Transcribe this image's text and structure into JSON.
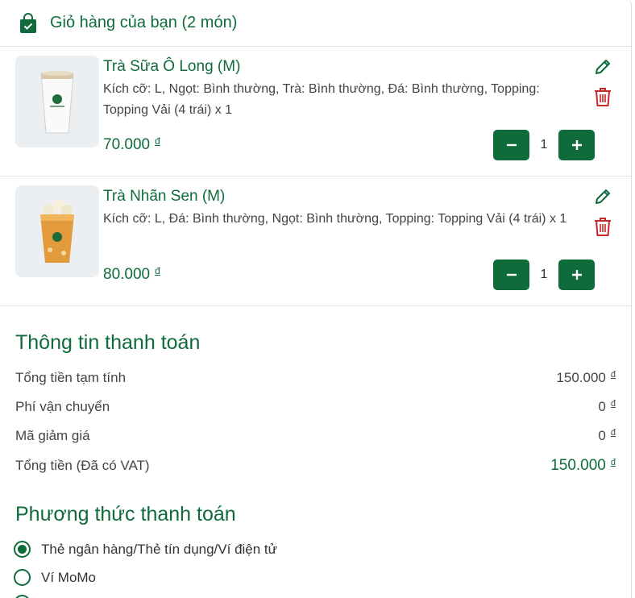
{
  "cart": {
    "title": "Giỏ hàng của bạn (2 món)",
    "icon": "shopping-bag-icon",
    "items": [
      {
        "name": "Trà Sữa Ô Long (M)",
        "description": "Kích cỡ: L, Ngọt: Bình thường, Trà: Bình thường, Đá: Bình thường, Topping: Topping Vải (4 trái) x 1",
        "price": "70.000",
        "currency": "đ",
        "quantity": "1"
      },
      {
        "name": "Trà Nhãn Sen (M)",
        "description": "Kích cỡ: L, Đá: Bình thường, Ngọt: Bình thường, Topping: Topping Vải (4 trái) x 1",
        "price": "80.000",
        "currency": "đ",
        "quantity": "1"
      }
    ]
  },
  "payment_info": {
    "title": "Thông tin thanh toán",
    "rows": [
      {
        "label": "Tổng tiền tạm tính",
        "value": "150.000",
        "currency": "đ"
      },
      {
        "label": "Phí vận chuyển",
        "value": "0",
        "currency": "đ"
      },
      {
        "label": "Mã giảm giá",
        "value": "0",
        "currency": "đ"
      },
      {
        "label": "Tổng tiền (Đã có VAT)",
        "value": "150.000",
        "currency": "đ"
      }
    ]
  },
  "payment_method": {
    "title": "Phương thức thanh toán",
    "options": [
      {
        "label": "Thẻ ngân hàng/Thẻ tín dụng/Ví điện tử",
        "selected": true
      },
      {
        "label": "Ví MoMo",
        "selected": false
      }
    ]
  },
  "colors": {
    "brand": "#0f6b3a",
    "delete": "#c62828",
    "thumb_bg": "#eceff2"
  }
}
